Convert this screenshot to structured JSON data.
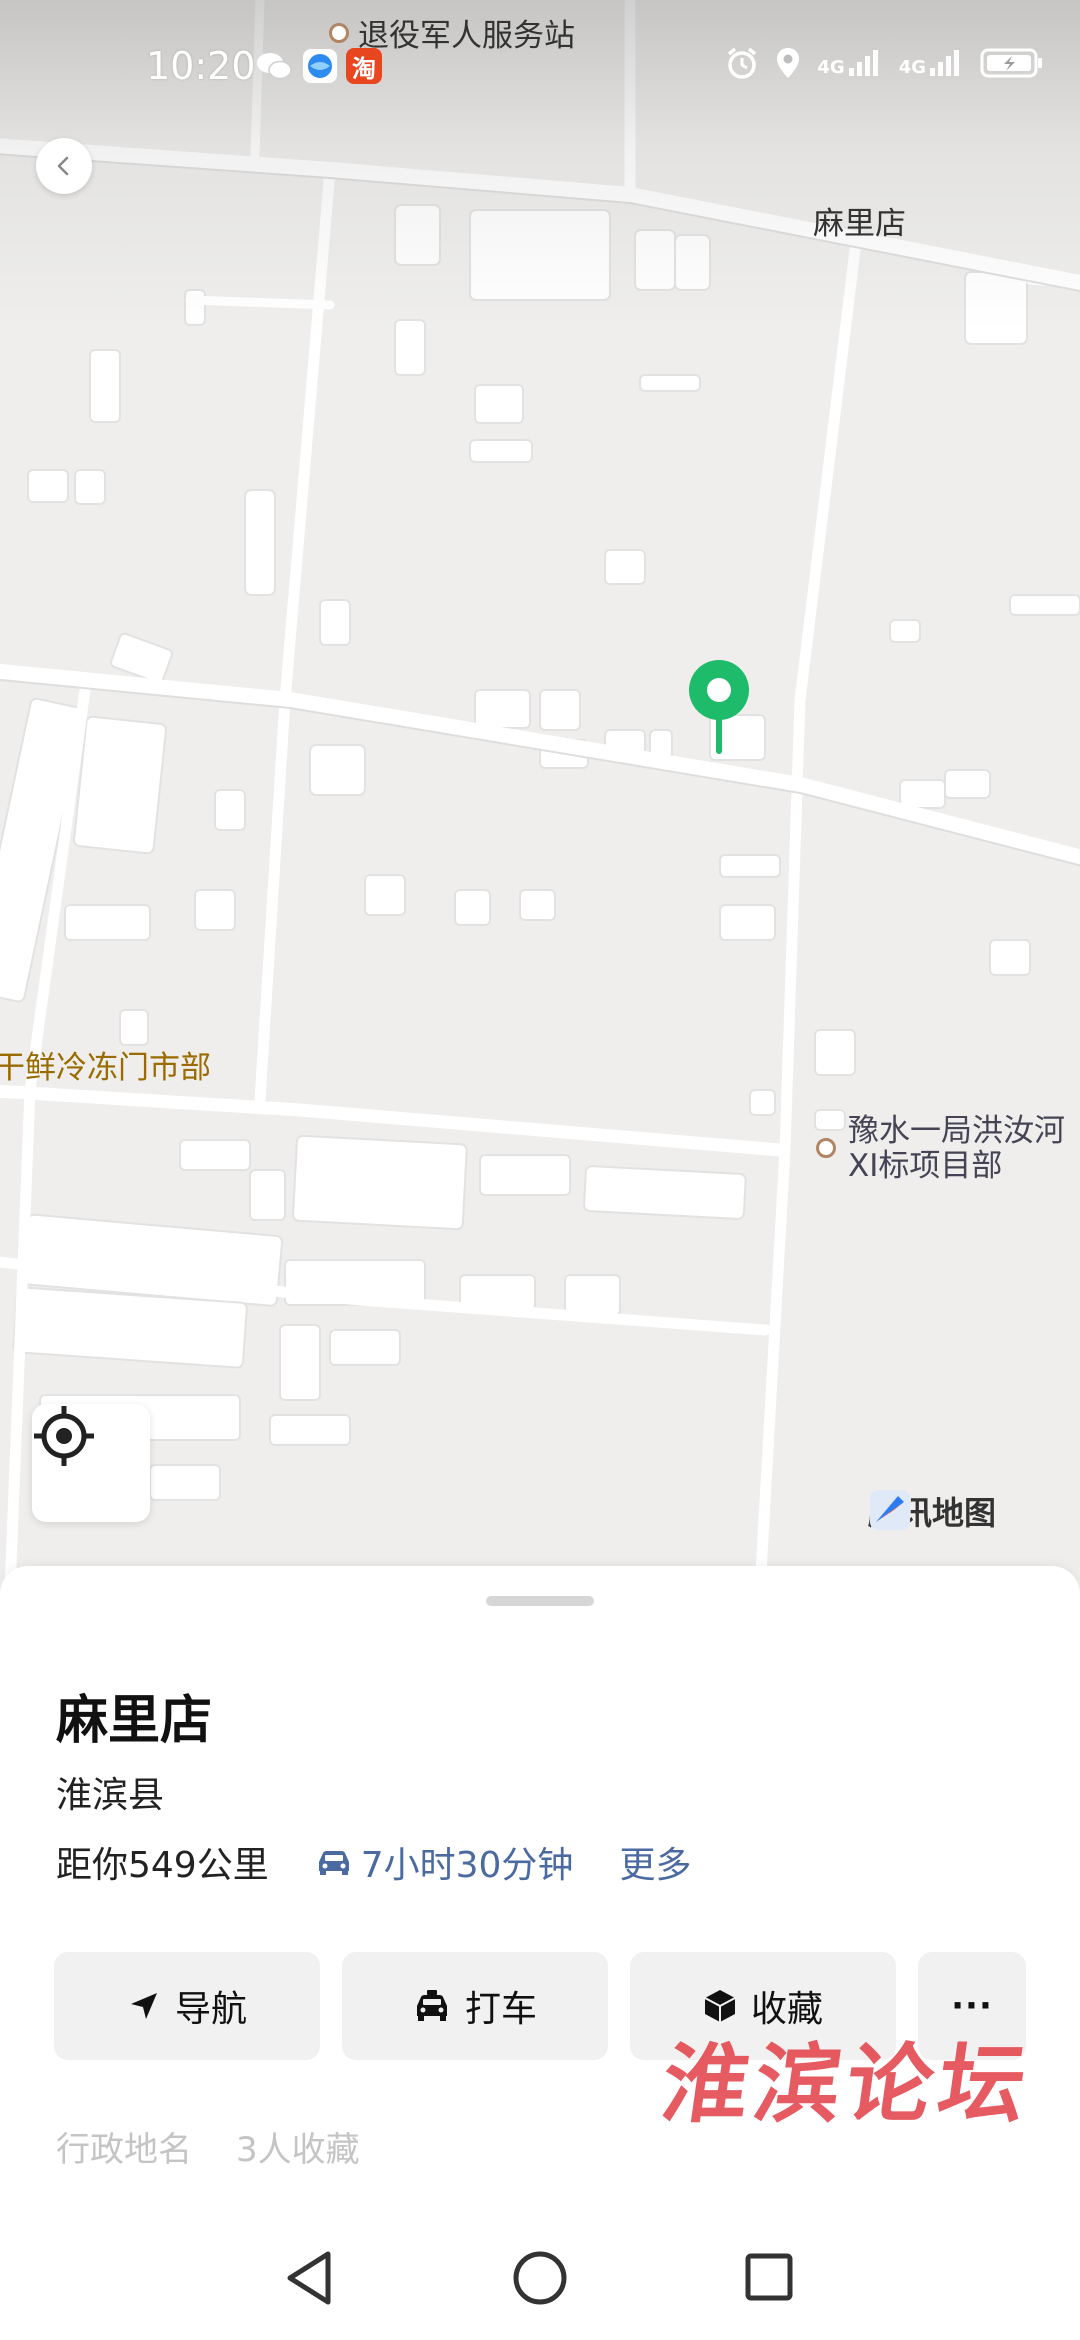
{
  "status_bar": {
    "time": "10:20",
    "left_icons": [
      "wechat-icon",
      "browser-icon",
      "taobao-icon"
    ],
    "taobao_label": "淘",
    "right_icons": [
      "alarm-icon",
      "location-icon",
      "signal-4g-icon",
      "signal-4g-icon",
      "battery-charging-icon"
    ],
    "network_label": "4G"
  },
  "map": {
    "labels": {
      "veteran_service": "退役军人服务站",
      "malidian_map": "麻里店",
      "frozen_store": "干鲜冷冻门市部",
      "project_line1": "豫水一局洪汝河",
      "project_line2": "XI标项目部"
    },
    "provider": "腾讯地图",
    "marker_color": "#1dbb6a"
  },
  "sheet": {
    "title": "麻里店",
    "region": "淮滨县",
    "distance": "距你549公里",
    "drive_time": "7小时30分钟",
    "more": "更多",
    "actions": {
      "navigate": "导航",
      "taxi": "打车",
      "favorite": "收藏",
      "more_symbol": "···"
    },
    "meta": {
      "category": "行政地名",
      "favorites_count": "3人收藏"
    }
  },
  "watermark": "淮滨论坛",
  "colors": {
    "accent_link": "#4a6aa0",
    "marker_green": "#1dbb6a",
    "watermark_red": "#e1323a"
  }
}
